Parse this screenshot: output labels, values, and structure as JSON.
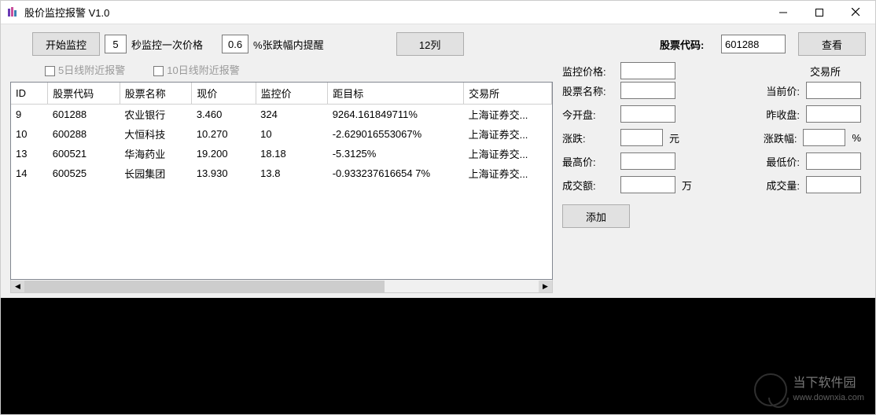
{
  "window": {
    "title": "股价监控报警   V1.0"
  },
  "toolbar": {
    "start_button": "开始监控",
    "interval_value": "5",
    "interval_label": "秒监控一次价格",
    "threshold_value": "0.6",
    "threshold_label": "%张跌幅内提醒",
    "columns_button": "12列"
  },
  "checkboxes": {
    "five_day": "5日线附近报警",
    "ten_day": "10日线附近报警"
  },
  "table": {
    "headers": [
      "ID",
      "股票代码",
      "股票名称",
      "现价",
      "监控价",
      "距目标",
      "交易所"
    ],
    "rows": [
      {
        "id": "9",
        "code": "601288",
        "name": "农业银行",
        "price": "3.460",
        "watch": "324",
        "diff": "9264.161849711%",
        "exch": "上海证券交..."
      },
      {
        "id": "10",
        "code": "600288",
        "name": "大恒科技",
        "price": "10.270",
        "watch": "10",
        "diff": "-2.629016553067%",
        "exch": "上海证券交..."
      },
      {
        "id": "13",
        "code": "600521",
        "name": "华海药业",
        "price": "19.200",
        "watch": "18.18",
        "diff": "-5.3125%",
        "exch": "上海证券交..."
      },
      {
        "id": "14",
        "code": "600525",
        "name": "长园集团",
        "price": "13.930",
        "watch": "13.8",
        "diff": "-0.933237616654 7%",
        "exch": "上海证券交..."
      }
    ]
  },
  "details": {
    "code_label": "股票代码:",
    "code_value": "601288",
    "view_button": "查看",
    "watch_price_label": "监控价格:",
    "exchange_label": "交易所",
    "name_label": "股票名称:",
    "current_label": "当前价:",
    "open_label": "今开盘:",
    "prev_close_label": "昨收盘:",
    "change_label": "涨跌:",
    "change_unit": "元",
    "change_pct_label": "涨跌幅:",
    "change_pct_unit": "%",
    "high_label": "最高价:",
    "low_label": "最低价:",
    "amount_label": "成交额:",
    "amount_unit": "万",
    "volume_label": "成交量:",
    "add_button": "添加"
  },
  "watermark": {
    "cn": "当下软件园",
    "url": "www.downxia.com"
  }
}
